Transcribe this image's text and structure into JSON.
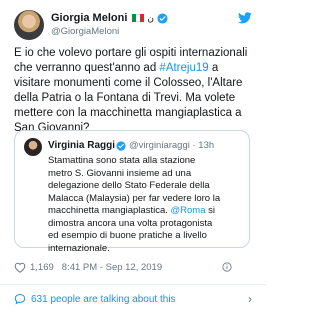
{
  "author": {
    "name": "Giorgia Meloni",
    "symbol": "ن",
    "handle": "@GiorgiaMeloni"
  },
  "tweet_text": {
    "before_hashtag": "E io che volevo portare gli ospiti internazionali\nche verranno quest'anno ad ",
    "hashtag": "#Atreju19",
    "after_hashtag": " a\nvisitare monumenti come il Colosseo, l'Altare\ndella Patria o la Fontana di Trevi. Ma volete\nmettere con la macchinetta mangiaplastica a\nSan Giovanni?"
  },
  "quoted": {
    "name": "Virginia Raggi",
    "handle": "@virginiaraggi · 13h",
    "text_before_mention": "Stamattina sono stata alla stazione\nmetro S. Giovanni insieme ad una\ndelegazione dello Stato Federale della\nMalacca (Malaysia) per far vedere loro la\nmacchinetta mangiaplastica. ",
    "mention": "@Roma",
    "text_after_mention": " si\ndimostra ancora una volta protagonista\ned esempio di buone pratiche a livello\ninternazionale."
  },
  "meta": {
    "likes": "1,169",
    "timestamp": "8:41 PM - Sep 12, 2019"
  },
  "footer": {
    "talking": "631 people are talking about this",
    "chevron": "›"
  },
  "colors": {
    "link": "#1b95e0",
    "verified": "#1da1f2",
    "secondary_text": "#657786"
  }
}
